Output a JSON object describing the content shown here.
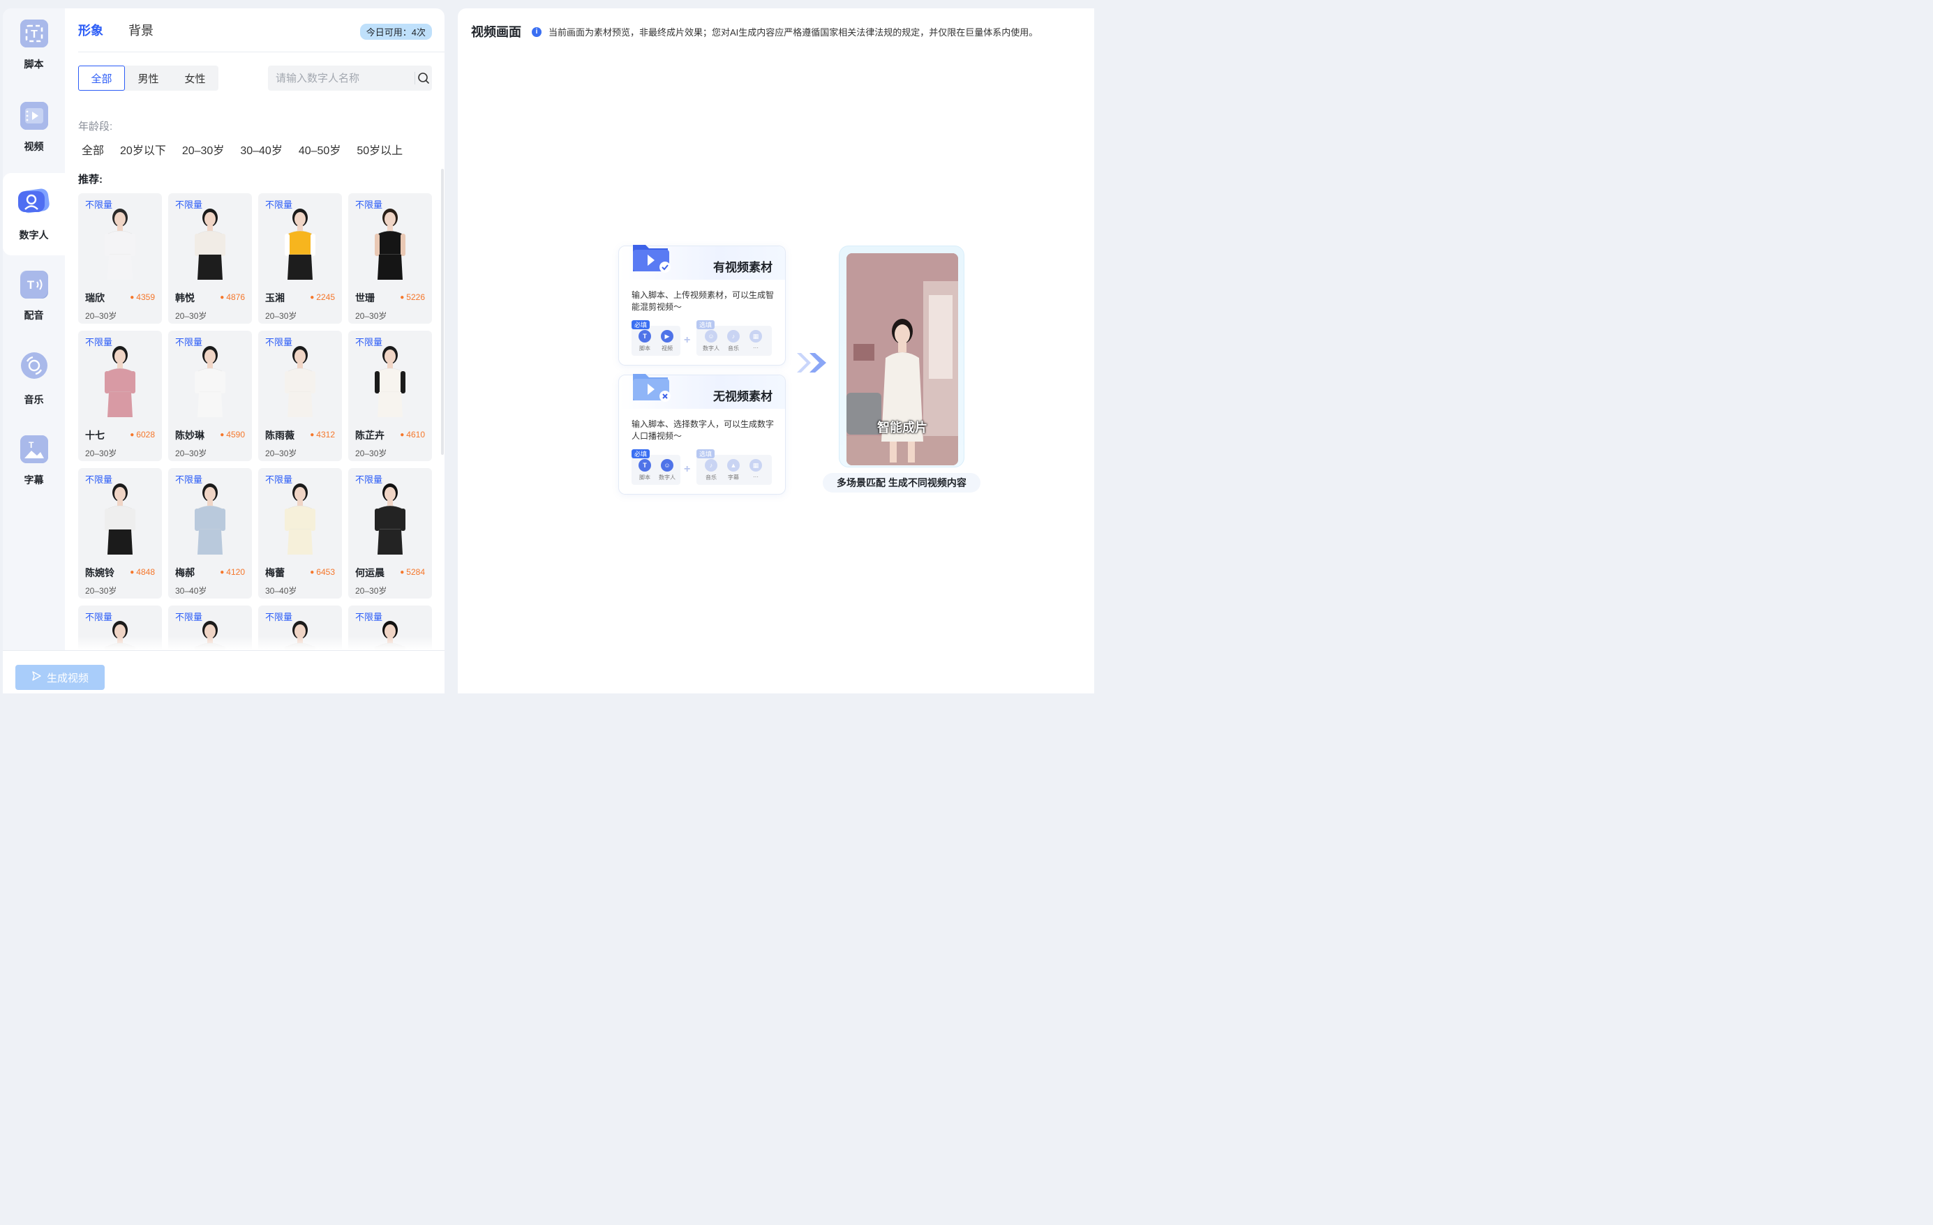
{
  "rail": {
    "items": [
      {
        "label": "脚本",
        "icon": "script-icon",
        "glyph": "T"
      },
      {
        "label": "视频",
        "icon": "video-icon",
        "glyph": "▶"
      },
      {
        "label": "数字人",
        "icon": "digital-human-icon",
        "glyph": "☺"
      },
      {
        "label": "配音",
        "icon": "voiceover-icon",
        "glyph": "T"
      },
      {
        "label": "音乐",
        "icon": "music-icon",
        "glyph": "♪"
      },
      {
        "label": "字幕",
        "icon": "subtitle-icon",
        "glyph": "▲"
      }
    ],
    "active_index": 2
  },
  "panel": {
    "tabs": [
      {
        "label": "形象"
      },
      {
        "label": "背景"
      }
    ],
    "quota": "今日可用：4次",
    "gender": [
      {
        "label": "全部"
      },
      {
        "label": "男性"
      },
      {
        "label": "女性"
      }
    ],
    "search_placeholder": "请输入数字人名称",
    "age_title": "年龄段:",
    "ages": [
      "全部",
      "20岁以下",
      "20–30岁",
      "30–40岁",
      "40–50岁",
      "50岁以上"
    ],
    "recommend_title": "推荐:",
    "cards": [
      {
        "tag": "不限量",
        "name": "瑞欣",
        "heat": "4359",
        "age": "20–30岁",
        "top": "#f4f4f6",
        "bottom": "#f4f4f6",
        "hair": "#2a2a2a",
        "sleeve": "#f4f4f6"
      },
      {
        "tag": "不限量",
        "name": "韩悦",
        "heat": "4876",
        "age": "20–30岁",
        "top": "#f1ece6",
        "bottom": "#1d1d1d",
        "hair": "#1b1b1b",
        "sleeve": "#f1ece6"
      },
      {
        "tag": "不限量",
        "name": "玉湘",
        "heat": "2245",
        "age": "20–30岁",
        "top": "#f7b51e",
        "bottom": "#1d1d1d",
        "hair": "#1b1b1b",
        "sleeve": "#ffffff"
      },
      {
        "tag": "不限量",
        "name": "世珊",
        "heat": "5226",
        "age": "20–30岁",
        "top": "#151515",
        "bottom": "#151515",
        "hair": "#2a2018",
        "sleeve": "#e9c8b4"
      },
      {
        "tag": "不限量",
        "name": "十七",
        "heat": "6028",
        "age": "20–30岁",
        "top": "#d89aa4",
        "bottom": "#d89aa4",
        "hair": "#1b1b1b",
        "sleeve": "#d89aa4"
      },
      {
        "tag": "不限量",
        "name": "陈妙琳",
        "heat": "4590",
        "age": "20–30岁",
        "top": "#f7f7f7",
        "bottom": "#f7f7f7",
        "hair": "#1b1b1b",
        "sleeve": "#f7f7f7"
      },
      {
        "tag": "不限量",
        "name": "陈雨薇",
        "heat": "4312",
        "age": "20–30岁",
        "top": "#f5f2ee",
        "bottom": "#f5f2ee",
        "hair": "#1b1b1b",
        "sleeve": "#f5f2ee"
      },
      {
        "tag": "不限量",
        "name": "陈芷卉",
        "heat": "4610",
        "age": "20–30岁",
        "top": "#f7f4ef",
        "bottom": "#f7f4ef",
        "hair": "#1b1b1b",
        "sleeve": "#1b1b1b"
      },
      {
        "tag": "不限量",
        "name": "陈婉铃",
        "heat": "4848",
        "age": "20–30岁",
        "top": "#eeeeee",
        "bottom": "#1b1b1b",
        "hair": "#1b1b1b",
        "sleeve": "#eeeeee"
      },
      {
        "tag": "不限量",
        "name": "梅郝",
        "heat": "4120",
        "age": "30–40岁",
        "top": "#b9c9dc",
        "bottom": "#b9c9dc",
        "hair": "#1b1b1b",
        "sleeve": "#b9c9dc"
      },
      {
        "tag": "不限量",
        "name": "梅蕾",
        "heat": "6453",
        "age": "30–40岁",
        "top": "#f6f0da",
        "bottom": "#f6f0da",
        "hair": "#1b1b1b",
        "sleeve": "#f6f0da"
      },
      {
        "tag": "不限量",
        "name": "何运晨",
        "heat": "5284",
        "age": "20–30岁",
        "top": "#232323",
        "bottom": "#232323",
        "hair": "#111111",
        "sleeve": "#232323"
      },
      {
        "tag": "不限量",
        "name": "",
        "heat": "",
        "age": "",
        "top": "#e9e9e9",
        "bottom": "#e9e9e9",
        "hair": "#1b1b1b",
        "sleeve": "#e9e9e9"
      },
      {
        "tag": "不限量",
        "name": "",
        "heat": "",
        "age": "",
        "top": "#e9e9e9",
        "bottom": "#e9e9e9",
        "hair": "#1b1b1b",
        "sleeve": "#e9e9e9"
      },
      {
        "tag": "不限量",
        "name": "",
        "heat": "",
        "age": "",
        "top": "#e9e9e9",
        "bottom": "#e9e9e9",
        "hair": "#1b1b1b",
        "sleeve": "#e9e9e9"
      },
      {
        "tag": "不限量",
        "name": "",
        "heat": "",
        "age": "",
        "top": "#e9e9e9",
        "bottom": "#e9e9e9",
        "hair": "#111111",
        "sleeve": "#e9e9e9"
      }
    ]
  },
  "bottom": {
    "generate_label": "生成视频"
  },
  "preview": {
    "title": "视频画面",
    "notice": "当前画面为素材预览，非最终成片效果；您对AI生成内容应严格遵循国家相关法律法规的规定，并仅限在巨量体系内使用。",
    "with_video": {
      "title": "有视频素材",
      "desc": "输入脚本、上传视频素材，可以生成智能混剪视频～",
      "required_tag": "必填",
      "optional_tag": "选填",
      "required": [
        "脚本",
        "视频"
      ],
      "optional": [
        "数字人",
        "音乐",
        "···"
      ]
    },
    "without_video": {
      "title": "无视频素材",
      "desc": "输入脚本、选择数字人，可以生成数字人口播视频～",
      "required_tag": "必填",
      "optional_tag": "选填",
      "required": [
        "脚本",
        "数字人"
      ],
      "optional": [
        "音乐",
        "字幕",
        "···"
      ]
    },
    "result_caption": "智能成片",
    "result_label": "多场景匹配 生成不同视频内容"
  },
  "colors": {
    "accent": "#2b5cf6",
    "heat": "#f5762a",
    "button_disabled": "#a9cdfa"
  }
}
